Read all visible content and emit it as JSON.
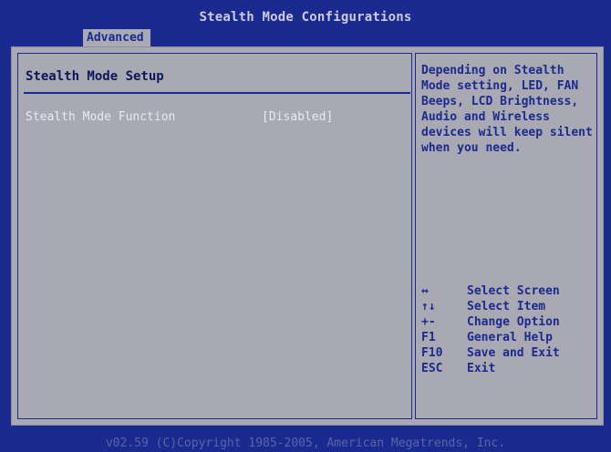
{
  "header": {
    "title": "Stealth Mode Configurations",
    "active_tab": "Advanced"
  },
  "main": {
    "section_title": "Stealth Mode Setup",
    "settings": [
      {
        "label": "Stealth Mode Function",
        "value": "[Disabled]"
      }
    ]
  },
  "help": {
    "text": "Depending on Stealth Mode setting, LED, FAN Beeps, LCD Brightness, Audio and Wireless devices will keep silent when you need.",
    "keys": [
      {
        "key": "↔",
        "desc": "Select Screen"
      },
      {
        "key": "↑↓",
        "desc": "Select Item"
      },
      {
        "key": "+-",
        "desc": "Change Option"
      },
      {
        "key": "F1",
        "desc": "General Help"
      },
      {
        "key": "F10",
        "desc": "Save and Exit"
      },
      {
        "key": "ESC",
        "desc": "Exit"
      }
    ]
  },
  "footer": {
    "text": "v02.59 (C)Copyright 1985-2005, American Megatrends, Inc."
  }
}
